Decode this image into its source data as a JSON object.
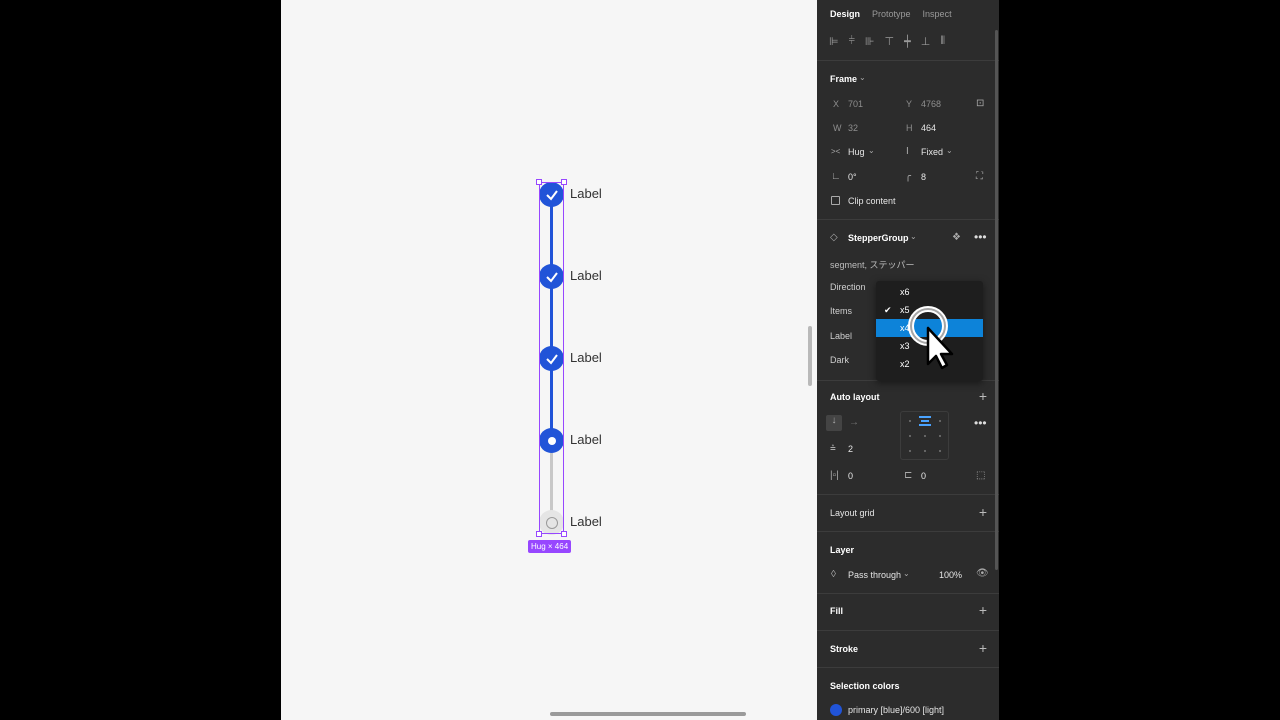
{
  "stepper": {
    "steps": [
      {
        "label": "Label",
        "state": "done"
      },
      {
        "label": "Label",
        "state": "done"
      },
      {
        "label": "Label",
        "state": "done"
      },
      {
        "label": "Label",
        "state": "current"
      },
      {
        "label": "Label",
        "state": "todo"
      }
    ],
    "badge": "Hug × 464"
  },
  "colors": {
    "primary": "#2154d8",
    "selection": "#9747ff",
    "highlight": "#0d83d9"
  },
  "panel": {
    "tabs": [
      "Design",
      "Prototype",
      "Inspect"
    ],
    "active_tab": "Design",
    "frame": {
      "title": "Frame",
      "x_label": "X",
      "x": "701",
      "y_label": "Y",
      "y": "4768",
      "w_label": "W",
      "w": "32",
      "h_label": "H",
      "h": "464",
      "h_sizing": "Hug",
      "v_sizing": "Fixed",
      "rotation": "0°",
      "radius": "8",
      "clip_label": "Clip content"
    },
    "component": {
      "name": "StepperGroup",
      "description": "segment, ステッパー",
      "props": [
        "Direction",
        "Items",
        "Label",
        "Dark"
      ]
    },
    "dropdown": {
      "options": [
        "x6",
        "x5",
        "x4",
        "x3",
        "x2"
      ],
      "checked": "x5",
      "highlighted": "x4"
    },
    "auto_layout": {
      "title": "Auto layout",
      "gap": "2",
      "padding_h": "0",
      "padding_v": "0"
    },
    "layout_grid": {
      "title": "Layout grid"
    },
    "layer": {
      "title": "Layer",
      "blend": "Pass through",
      "opacity": "100%"
    },
    "fill": {
      "title": "Fill"
    },
    "stroke": {
      "title": "Stroke"
    },
    "selection_colors": {
      "title": "Selection colors",
      "color_name": "primary [blue]/600 [light]"
    }
  }
}
